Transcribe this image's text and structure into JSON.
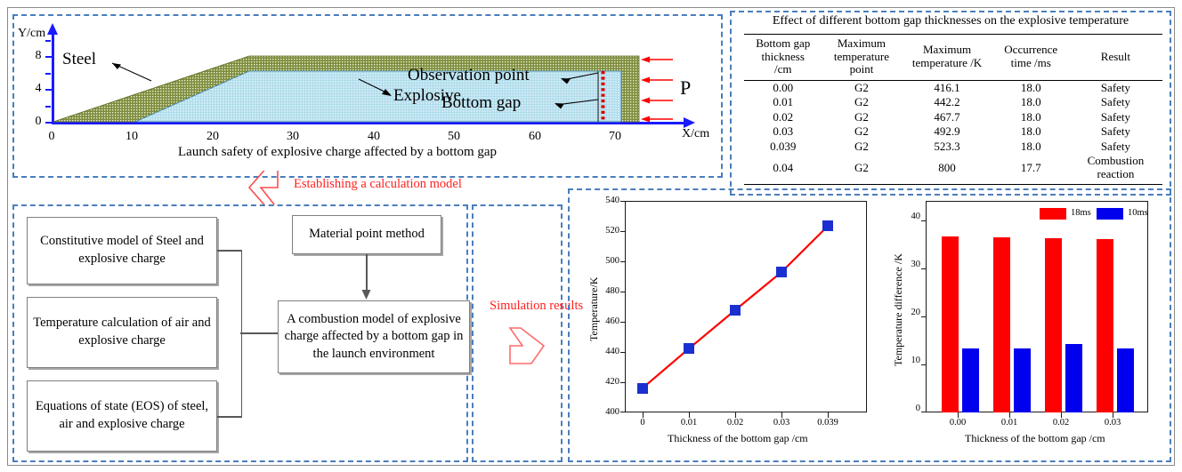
{
  "diagram": {
    "y_axis_label": "Y/cm",
    "x_axis_label": "X/cm",
    "y_ticks": [
      "0",
      "4",
      "8"
    ],
    "x_ticks": [
      "0",
      "10",
      "20",
      "30",
      "40",
      "50",
      "60",
      "70"
    ],
    "caption": "Launch safety of explosive charge affected by a bottom gap",
    "labels": {
      "steel": "Steel",
      "explosive": "Explosive",
      "observation_point": "Observation point",
      "bottom_gap": "Bottom gap",
      "pressure": "P"
    },
    "colors": {
      "steel": "#7d8c3c",
      "explosive": "#add8e6",
      "axis": "#1a1aff",
      "gap": "#d40000",
      "pressure_arrow": "#ff0000"
    }
  },
  "table": {
    "title": "Effect of different bottom gap thicknesses on the explosive temperature",
    "columns": [
      "Bottom gap thickness /cm",
      "Maximum temperature point",
      "Maximum temperature /K",
      "Occurrence time /ms",
      "Result"
    ],
    "columns_lines": [
      [
        "Bottom gap",
        "thickness",
        "/cm"
      ],
      [
        "Maximum",
        "temperature",
        "point"
      ],
      [
        "Maximum",
        "temperature /K"
      ],
      [
        "Occurrence",
        "time /ms"
      ],
      [
        "Result"
      ]
    ],
    "rows": [
      {
        "thickness": "0.00",
        "point": "G2",
        "tmax": "416.1",
        "time": "18.0",
        "result": "Safety"
      },
      {
        "thickness": "0.01",
        "point": "G2",
        "tmax": "442.2",
        "time": "18.0",
        "result": "Safety"
      },
      {
        "thickness": "0.02",
        "point": "G2",
        "tmax": "467.7",
        "time": "18.0",
        "result": "Safety"
      },
      {
        "thickness": "0.03",
        "point": "G2",
        "tmax": "492.9",
        "time": "18.0",
        "result": "Safety"
      },
      {
        "thickness": "0.039",
        "point": "G2",
        "tmax": "523.3",
        "time": "18.0",
        "result": "Safety"
      },
      {
        "thickness": "0.04",
        "point": "G2",
        "tmax": "800",
        "time": "17.7",
        "result": "Combustion reaction"
      }
    ]
  },
  "flow": {
    "establishing_label": "Establishing a calculation model",
    "simulation_label": "Simulation results",
    "boxes": {
      "constitutive": "Constitutive model of Steel and explosive charge",
      "temperature": "Temperature calculation of air and explosive charge",
      "eos": "Equations of state (EOS) of steel, air  and explosive charge",
      "mpm": "Material point method",
      "combustion": "A  combustion model of explosive charge affected by a bottom gap in the launch environment"
    },
    "accent_color": "#ff2020"
  },
  "chart_data": [
    {
      "type": "line",
      "title": "",
      "xlabel": "Thickness of the bottom gap /cm",
      "ylabel": "Temperature/K",
      "categories": [
        "0",
        "0.01",
        "0.02",
        "0.03",
        "0.039"
      ],
      "values": [
        416.1,
        442.2,
        467.7,
        492.9,
        523.3
      ],
      "ylim": [
        400,
        540
      ],
      "yticks": [
        400,
        420,
        440,
        460,
        480,
        500,
        520,
        540
      ],
      "grid": false,
      "legend": "none",
      "line_color": "#ff0000",
      "marker_color": "#1a2fd0",
      "marker": "square"
    },
    {
      "type": "bar",
      "title": "",
      "xlabel": "Thickness of the bottom gap /cm",
      "ylabel": "Temperature difference /K",
      "categories": [
        "0.00",
        "0.01",
        "0.02",
        "0.03"
      ],
      "series": [
        {
          "name": "18ms",
          "values": [
            36.6,
            36.4,
            36.2,
            36.0
          ],
          "color": "#ff0000"
        },
        {
          "name": "10ms",
          "values": [
            13.4,
            13.4,
            14.2,
            13.4
          ],
          "color": "#0000ee"
        }
      ],
      "ylim": [
        0,
        44
      ],
      "yticks": [
        0,
        10,
        20,
        30,
        40
      ],
      "grid": false,
      "legend": "top-right"
    }
  ]
}
